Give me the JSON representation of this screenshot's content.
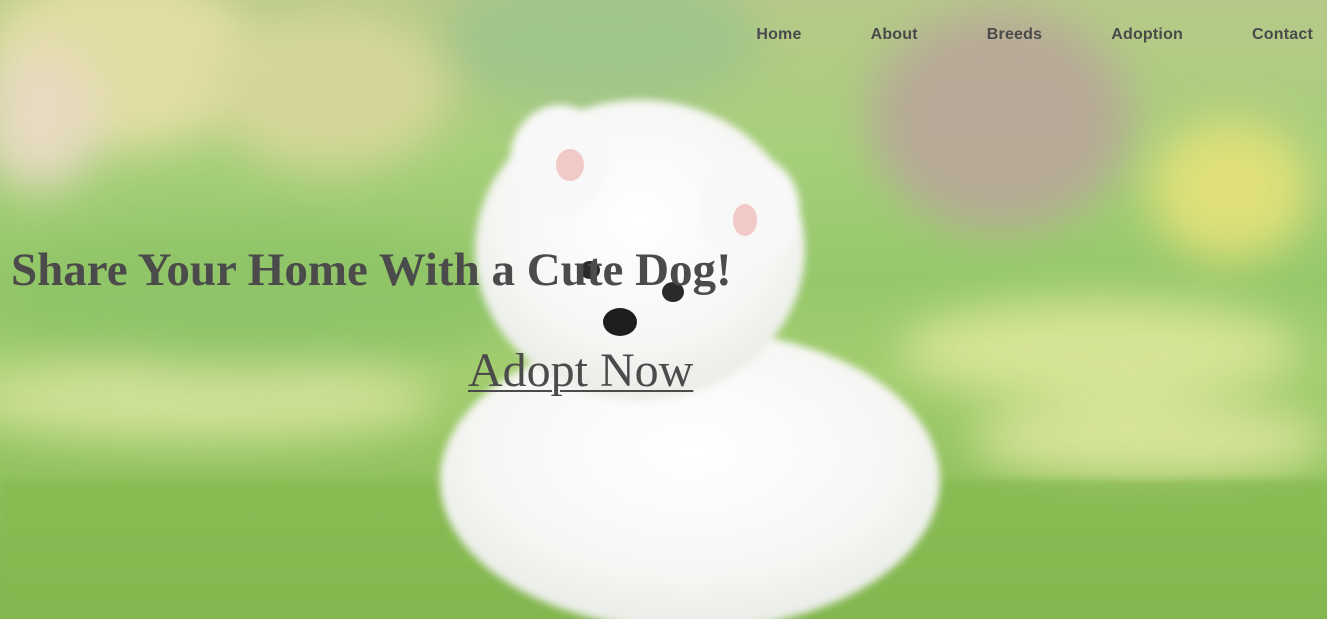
{
  "nav": {
    "items": [
      {
        "label": "Home"
      },
      {
        "label": "About"
      },
      {
        "label": "Breeds"
      },
      {
        "label": "Adoption"
      },
      {
        "label": "Contact"
      }
    ]
  },
  "hero": {
    "headline": "Share Your Home With a Cute Dog!",
    "cta_label": "Adopt Now",
    "image_subject": "white fluffy puppy sitting on grass"
  },
  "colors": {
    "text": "#4b4b4b",
    "grass": "#8fc05c",
    "dog": "#f7f7f7"
  }
}
